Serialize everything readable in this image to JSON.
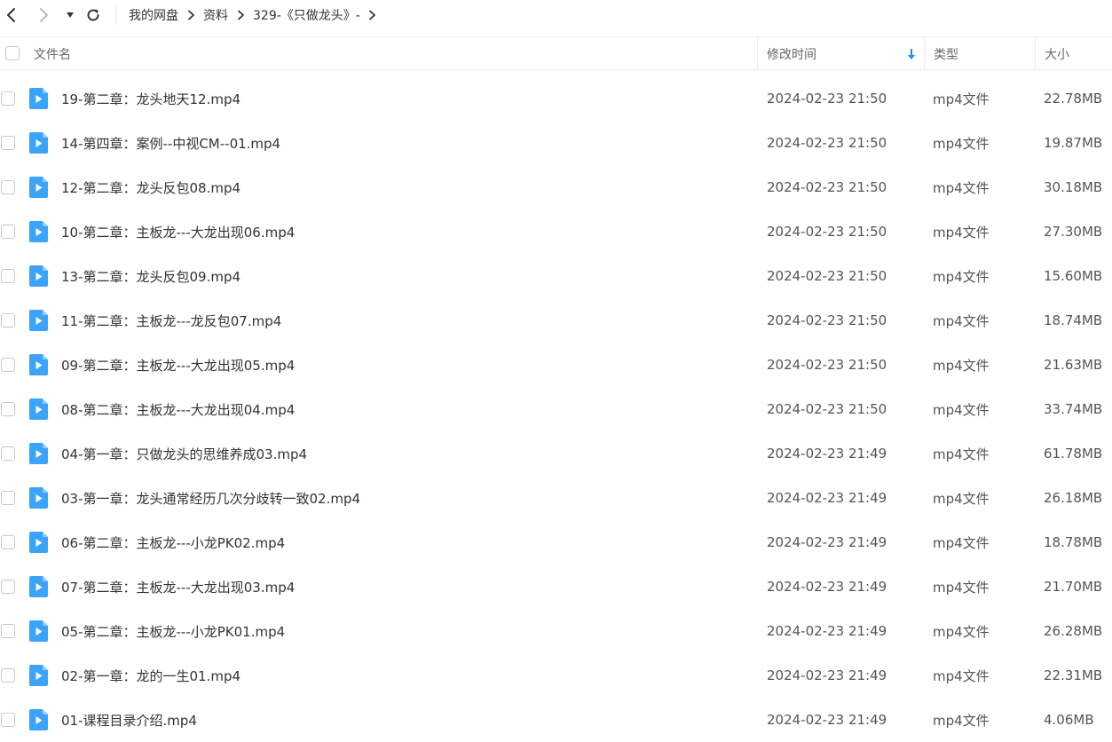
{
  "breadcrumb": {
    "items": [
      "我的网盘",
      "资料",
      "329-《只做龙头》-"
    ]
  },
  "header": {
    "name": "文件名",
    "modified": "修改时间",
    "type": "类型",
    "size": "大小"
  },
  "icons": {
    "back": "back-arrow-icon",
    "forward": "forward-arrow-icon",
    "dropdown": "caret-down-icon",
    "refresh": "refresh-icon",
    "sort": "sort-down-arrow-icon",
    "file": "video-file-icon"
  },
  "colors": {
    "accent": "#1a8cff",
    "file_icon": "#3ba4f8"
  },
  "files": [
    {
      "name": "19-第二章：龙头地天12.mp4",
      "date": "2024-02-23 21:50",
      "type": "mp4文件",
      "size": "22.78MB"
    },
    {
      "name": "14-第四章：案例--中视CM--01.mp4",
      "date": "2024-02-23 21:50",
      "type": "mp4文件",
      "size": "19.87MB"
    },
    {
      "name": "12-第二章：龙头反包08.mp4",
      "date": "2024-02-23 21:50",
      "type": "mp4文件",
      "size": "30.18MB"
    },
    {
      "name": "10-第二章：主板龙---大龙出现06.mp4",
      "date": "2024-02-23 21:50",
      "type": "mp4文件",
      "size": "27.30MB"
    },
    {
      "name": "13-第二章：龙头反包09.mp4",
      "date": "2024-02-23 21:50",
      "type": "mp4文件",
      "size": "15.60MB"
    },
    {
      "name": "11-第二章：主板龙---龙反包07.mp4",
      "date": "2024-02-23 21:50",
      "type": "mp4文件",
      "size": "18.74MB"
    },
    {
      "name": "09-第二章：主板龙---大龙出现05.mp4",
      "date": "2024-02-23 21:50",
      "type": "mp4文件",
      "size": "21.63MB"
    },
    {
      "name": "08-第二章：主板龙---大龙出现04.mp4",
      "date": "2024-02-23 21:50",
      "type": "mp4文件",
      "size": "33.74MB"
    },
    {
      "name": "04-第一章：只做龙头的思维养成03.mp4",
      "date": "2024-02-23 21:49",
      "type": "mp4文件",
      "size": "61.78MB"
    },
    {
      "name": "03-第一章：龙头通常经历几次分歧转一致02.mp4",
      "date": "2024-02-23 21:49",
      "type": "mp4文件",
      "size": "26.18MB"
    },
    {
      "name": "06-第二章：主板龙---小龙PK02.mp4",
      "date": "2024-02-23 21:49",
      "type": "mp4文件",
      "size": "18.78MB"
    },
    {
      "name": "07-第二章：主板龙---大龙出现03.mp4",
      "date": "2024-02-23 21:49",
      "type": "mp4文件",
      "size": "21.70MB"
    },
    {
      "name": "05-第二章：主板龙---小龙PK01.mp4",
      "date": "2024-02-23 21:49",
      "type": "mp4文件",
      "size": "26.28MB"
    },
    {
      "name": "02-第一章：龙的一生01.mp4",
      "date": "2024-02-23 21:49",
      "type": "mp4文件",
      "size": "22.31MB"
    },
    {
      "name": "01-课程目录介绍.mp4",
      "date": "2024-02-23 21:49",
      "type": "mp4文件",
      "size": "4.06MB"
    }
  ]
}
